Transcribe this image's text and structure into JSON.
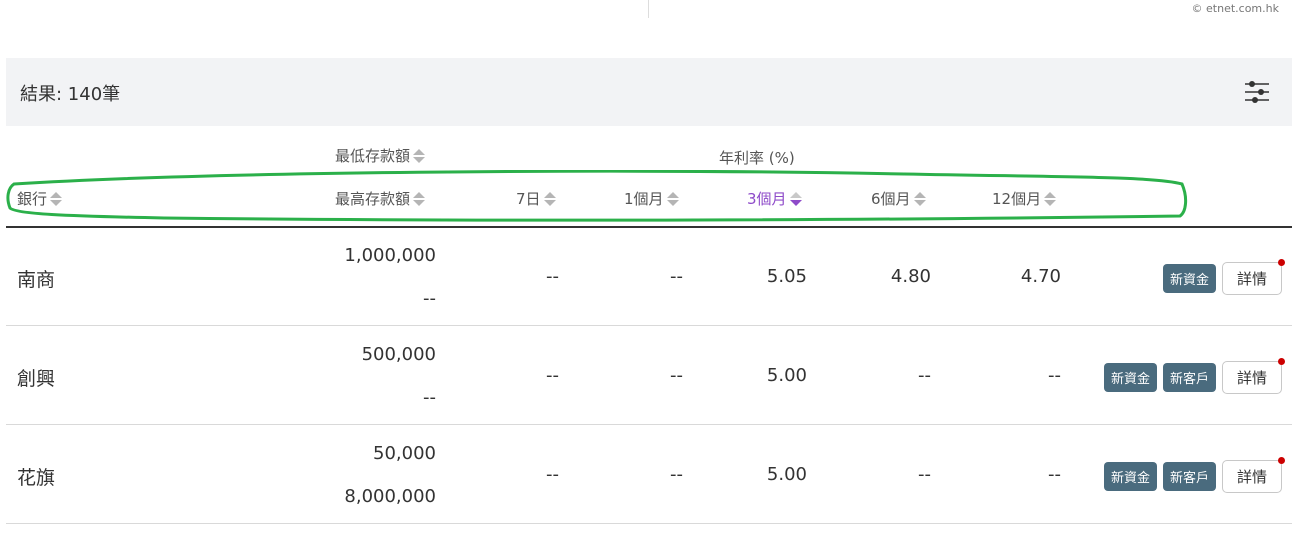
{
  "watermark": "© etnet.com.hk",
  "results": {
    "label": "結果: 140筆",
    "filter_icon": "sliders-icon"
  },
  "headers": {
    "min_deposit": "最低存款額",
    "annual_rate": "年利率 (%)",
    "bank": "銀行",
    "max_deposit": "最高存款額",
    "d7": "7日",
    "m1": "1個月",
    "m3": "3個月",
    "m6": "6個月",
    "m12": "12個月",
    "sorted_column": "3個月",
    "sort_direction": "descending"
  },
  "rows": [
    {
      "bank": "南商",
      "min": "1,000,000",
      "max": "--",
      "r7": "--",
      "r1m": "--",
      "r3m": "5.05",
      "r6m": "4.80",
      "r12m": "4.70",
      "badges": [
        "新資金"
      ],
      "detail": "詳情"
    },
    {
      "bank": "創興",
      "min": "500,000",
      "max": "--",
      "r7": "--",
      "r1m": "--",
      "r3m": "5.00",
      "r6m": "--",
      "r12m": "--",
      "badges": [
        "新資金",
        "新客戶"
      ],
      "detail": "詳情"
    },
    {
      "bank": "花旗",
      "min": "50,000",
      "max": "8,000,000",
      "r7": "--",
      "r1m": "--",
      "r3m": "5.00",
      "r6m": "--",
      "r12m": "--",
      "badges": [
        "新資金",
        "新客戶"
      ],
      "detail": "詳情"
    }
  ],
  "colors": {
    "active_sort": "#8e4bc9",
    "badge_bg": "#4a6b7e",
    "annotation_ring": "#2bb04a",
    "notify_dot": "#cc0000"
  }
}
